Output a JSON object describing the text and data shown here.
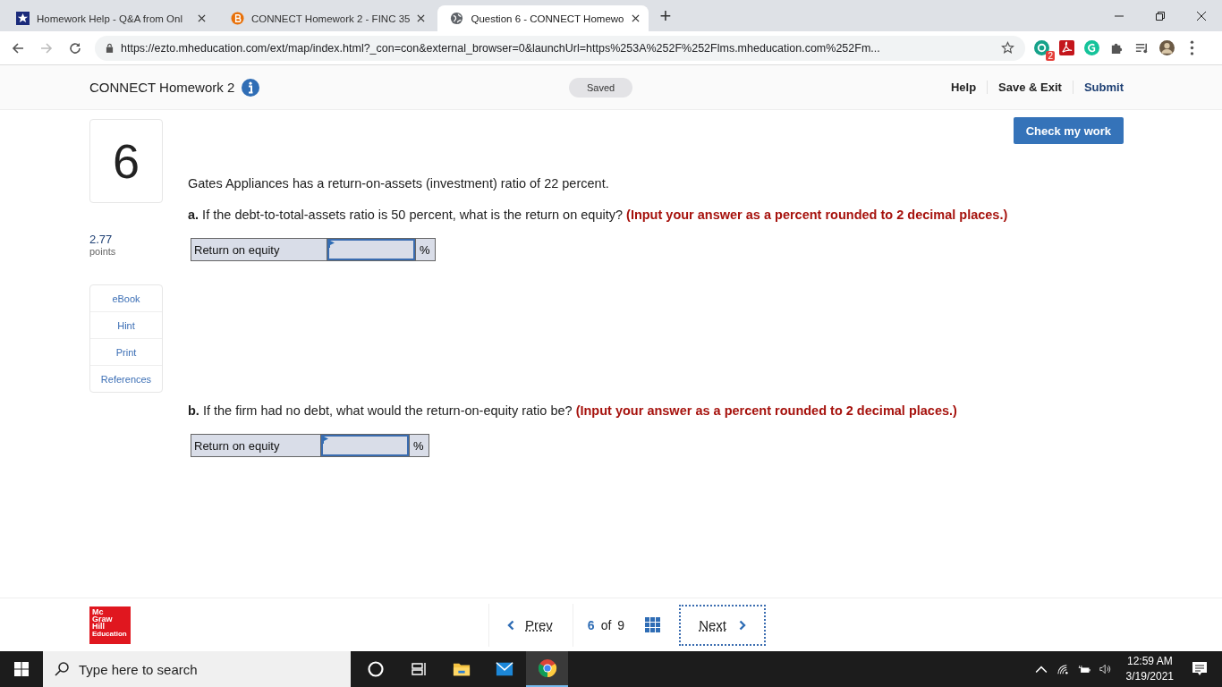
{
  "browser": {
    "tabs": [
      {
        "title": "Homework Help - Q&A from Onl",
        "selected": false
      },
      {
        "title": "CONNECT Homework 2 - FINC 35",
        "selected": false
      },
      {
        "title": "Question 6 - CONNECT Homewo",
        "selected": true
      }
    ],
    "new_tab": "+",
    "url": "https://ezto.mheducation.com/ext/map/index.html?_con=con&external_browser=0&launchUrl=https%253A%252F%252Flms.mheducation.com%252Fm...",
    "extension_badge": "2"
  },
  "header": {
    "title": "CONNECT Homework 2",
    "status": "Saved",
    "links": [
      "Help",
      "Save & Exit",
      "Submit"
    ]
  },
  "question": {
    "number": "6",
    "points": "2.77",
    "points_label": "points",
    "tools": [
      "eBook",
      "Hint",
      "Print",
      "References"
    ],
    "check_button": "Check my work",
    "intro": "Gates Appliances has a return-on-assets (investment) ratio of 22 percent.",
    "parts": [
      {
        "letter": "a.",
        "text": "If the debt-to-total-assets ratio is 50 percent, what is the return on equity?",
        "instruction": "(Input your answer as a percent rounded to 2 decimal places.)",
        "answer_label": "Return on equity",
        "unit": "%"
      },
      {
        "letter": "b.",
        "text": "If the firm had no debt, what would the return-on-equity ratio be?",
        "instruction": "(Input your answer as a percent rounded to 2 decimal places.)",
        "answer_label": "Return on equity",
        "unit": "%"
      }
    ]
  },
  "footer": {
    "logo": [
      "Mc",
      "Graw",
      "Hill",
      "Education"
    ],
    "prev": "Prev",
    "page": "6",
    "of": "of",
    "total": "9",
    "next": "Next"
  },
  "taskbar": {
    "search_placeholder": "Type here to search",
    "time": "12:59 AM",
    "date": "3/19/2021"
  }
}
